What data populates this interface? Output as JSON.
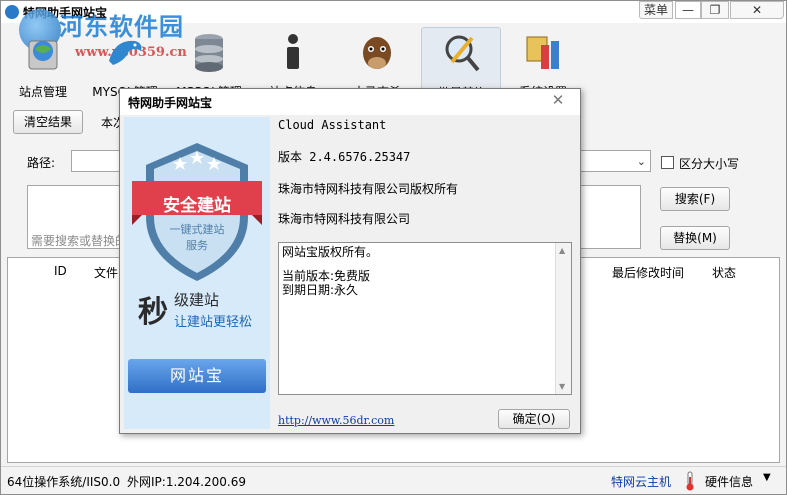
{
  "window": {
    "title": "特网助手网站宝",
    "menu_label": "菜单",
    "minimize_glyph": "—",
    "maximize_glyph": "❐",
    "close_glyph": "✕"
  },
  "watermark": {
    "line1": "河东软件园",
    "line2": "www.pc0359.cn"
  },
  "toolbar": {
    "items": [
      {
        "label": "站点管理",
        "icon": "site-icon"
      },
      {
        "label": "MYSQL管理",
        "icon": "mysql-dolphin-icon"
      },
      {
        "label": "MSSQL管理",
        "icon": "database-icon"
      },
      {
        "label": "站点信息",
        "icon": "info-icon"
      },
      {
        "label": "木马查杀",
        "icon": "horse-icon"
      },
      {
        "label": "批量替换",
        "icon": "magnifier-pencil-icon"
      },
      {
        "label": "系统设置",
        "icon": "settings-icon"
      }
    ]
  },
  "search_panel": {
    "clear_button": "清空结果",
    "scope_label": "本次",
    "path_label": "路径:",
    "path_value": "",
    "case_sensitive_label": "区分大小写",
    "search_button": "搜索(F)",
    "replace_button": "替换(M)",
    "placeholder": "需要搜索或替换的"
  },
  "results_grid": {
    "columns": [
      "ID",
      "文件",
      "\\",
      "最后修改时间",
      "状态"
    ],
    "rows": []
  },
  "status_bar": {
    "os": "64位操作系统/IIS0.0",
    "external_ip": "外网IP:1.204.200.69",
    "cloud_link": "特网云主机",
    "hardware_info": "硬件信息"
  },
  "about_dialog": {
    "title": "特网助手网站宝",
    "product_name": "Cloud Assistant",
    "version": "版本 2.4.6576.25347",
    "copyright": "珠海市特网科技有限公司版权所有",
    "company": "珠海市特网科技有限公司",
    "text_lines": [
      "网站宝版权所有。",
      "",
      "当前版本:免费版",
      "到期日期:永久"
    ],
    "link": "http://www.56dr.com",
    "ok_button": "确定(O)",
    "banner": {
      "ribbon_text": "安全建站",
      "shield_line1": "一键式建站",
      "shield_line2": "服务",
      "big_char": "秒",
      "slogan_line1": "级建站",
      "slogan_line2": "让建站更轻松",
      "button_text": "网站宝"
    }
  },
  "colors": {
    "accent_blue": "#2f6fc6",
    "link_blue": "#0b3ca9",
    "banner_bg": "#d7eafa",
    "ribbon_red": "#e0404b"
  }
}
